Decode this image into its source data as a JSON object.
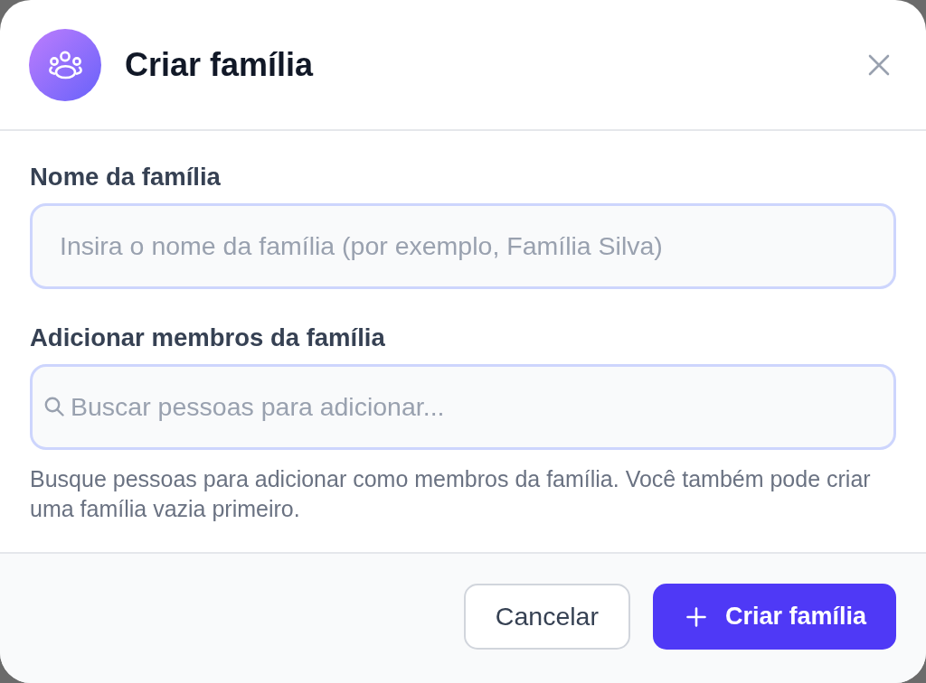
{
  "dialog": {
    "title": "Criar família"
  },
  "fields": [
    {
      "kind": "text",
      "label": "Nome da família",
      "placeholder": "Insira o nome da família (por exemplo, Família Silva)"
    },
    {
      "kind": "search",
      "label": "Adicionar membros da família",
      "placeholder": "Buscar pessoas para adicionar..."
    }
  ],
  "help_text": "Busque pessoas para adicionar como membros da família. Você também pode criar uma família vazia primeiro.",
  "buttons": [
    {
      "kind": "secondary",
      "label": "Cancelar"
    },
    {
      "kind": "primary",
      "label": "Criar família"
    }
  ]
}
